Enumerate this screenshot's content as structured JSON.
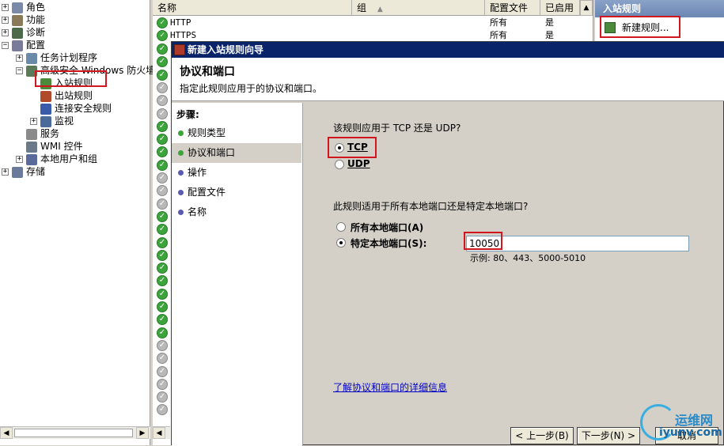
{
  "tree": {
    "items": [
      {
        "label": "角色",
        "pm": "+",
        "icon_color": "#7a8aa8"
      },
      {
        "label": "功能",
        "pm": "+",
        "icon_color": "#8a7a5a"
      },
      {
        "label": "诊断",
        "pm": "+",
        "icon_color": "#4a6a4a"
      },
      {
        "label": "配置",
        "pm": "−",
        "icon_color": "#7a7a9a"
      },
      {
        "label": "任务计划程序",
        "pm": "+",
        "icon_color": "#6a8aaa"
      },
      {
        "label": "高级安全 Windows 防火墙",
        "pm": "−",
        "icon_color": "#5a7a5a"
      },
      {
        "label": "入站规则",
        "pm": "",
        "icon_color": "#4a8a3a"
      },
      {
        "label": "出站规则",
        "pm": "",
        "icon_color": "#b04a2a"
      },
      {
        "label": "连接安全规则",
        "pm": "",
        "icon_color": "#3a5aaa"
      },
      {
        "label": "监视",
        "pm": "+",
        "icon_color": "#4a6a9a"
      },
      {
        "label": "服务",
        "pm": "",
        "icon_color": "#8a8a8a"
      },
      {
        "label": "WMI 控件",
        "pm": "",
        "icon_color": "#6a7a8a"
      },
      {
        "label": "本地用户和组",
        "pm": "+",
        "icon_color": "#5a6a9a"
      },
      {
        "label": "存储",
        "pm": "+",
        "icon_color": "#6a7a9a"
      }
    ]
  },
  "list": {
    "columns": [
      {
        "label": "名称"
      },
      {
        "label": "组",
        "sort": "▲"
      },
      {
        "label": "配置文件"
      },
      {
        "label": "已启用"
      }
    ],
    "rows": [
      {
        "name": "HTTP",
        "profile": "所有",
        "enabled": "是"
      },
      {
        "name": "HTTPS",
        "profile": "所有",
        "enabled": "是"
      }
    ]
  },
  "actions": {
    "header": "入站规则",
    "new_rule": "新建规则..."
  },
  "wizard": {
    "title": "新建入站规则向导",
    "page_title": "协议和端口",
    "page_desc": "指定此规则应用于的协议和端口。",
    "steps_label": "步骤:",
    "steps": [
      "规则类型",
      "协议和端口",
      "操作",
      "配置文件",
      "名称"
    ],
    "q1": "该规则应用于 TCP 还是 UDP?",
    "tcp": "TCP",
    "udp": "UDP",
    "q2": "此规则适用于所有本地端口还是特定本地端口?",
    "all_ports": "所有本地端口(A)",
    "specific_ports": "特定本地端口(S):",
    "port_value": "10050",
    "example": "示例: 80、443、5000-5010",
    "learn_more": "了解协议和端口的详细信息",
    "back": "< 上一步(B)",
    "next": "下一步(N) >",
    "cancel": "取消"
  },
  "watermark": {
    "text1": "运维网",
    "text2": "iyunv.com"
  },
  "colors": {
    "accent": "#0a246a",
    "highlight": "#d0161f",
    "enabled_check": "#3ba53b"
  }
}
